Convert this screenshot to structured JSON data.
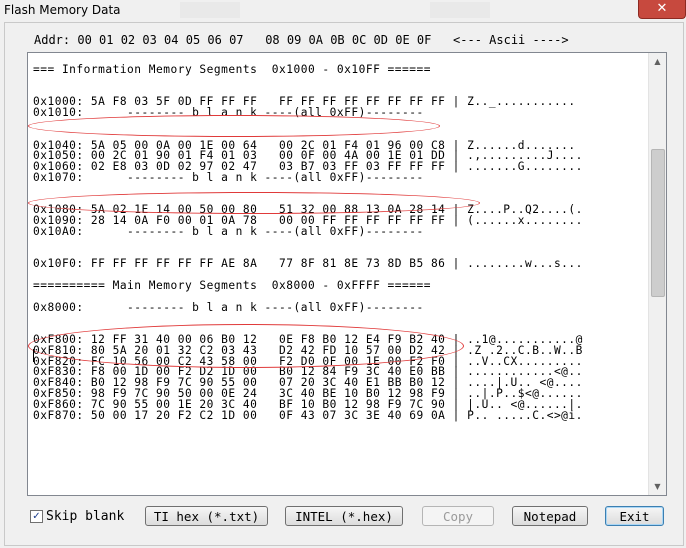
{
  "window": {
    "title": "Flash Memory Data",
    "close_glyph": "✕"
  },
  "header": {
    "addr_line": "Addr: 00 01 02 03 04 05 06 07   08 09 0A 0B 0C 0D 0E 0F   <--- Ascii ---->"
  },
  "dump": {
    "lines": [
      "=== Information Memory Segments  0x1000 - 0x10FF ======",
      "",
      "",
      "0x1000: 5A F8 03 5F 0D FF FF FF   FF FF FF FF FF FF FF FF | Z.._...........",
      "0x1010:      -------- b l a n k ----(all 0xFF)--------",
      "",
      "",
      "0x1040: 5A 05 00 0A 00 1E 00 64   00 2C 01 F4 01 96 00 C8 | Z......d.......",
      "0x1050: 00 2C 01 90 01 F4 01 03   00 0F 00 4A 00 1E 01 DD | .,.........J....",
      "0x1060: 02 E8 03 0D 02 97 02 47   03 B7 03 FF 03 FF FF FF | .......G........",
      "0x1070:      -------- b l a n k ----(all 0xFF)--------",
      "",
      "",
      "0x1080: 5A 02 1E 14 00 50 00 80   51 32 00 88 13 0A 28 14 | Z....P..Q2....(.",
      "0x1090: 28 14 0A F0 00 01 0A 78   00 00 FF FF FF FF FF FF | (......x........",
      "0x10A0:      -------- b l a n k ----(all 0xFF)--------",
      "",
      "",
      "0x10F0: FF FF FF FF FF FF AE 8A   77 8F 81 8E 73 8D B5 86 | ........w...s...",
      "",
      "========== Main Memory Segments  0x8000 - 0xFFFF ======",
      "",
      "0x8000:      -------- b l a n k ----(all 0xFF)--------",
      "",
      "",
      "0xF800: 12 FF 31 40 00 06 B0 12   0E F8 B0 12 E4 F9 B2 40 | ..1@...........@",
      "0xF810: 80 5A 20 01 32 C2 03 43   D2 42 FD 10 57 00 D2 42 | .Z .2..C.B..W..B",
      "0xF820: FC 10 56 00 C2 43 58 00   F2 D0 0F 00 1E 00 F2 F0 | ..V..CX.........",
      "0xF830: F8 00 1D 00 F2 D2 1D 00   B0 12 84 F9 3C 40 E0 BB | ............<@..",
      "0xF840: B0 12 98 F9 7C 90 55 00   07 20 3C 40 E1 BB B0 12 | ....|.U.. <@....",
      "0xF850: 98 F9 7C 90 50 00 0E 24   3C 40 BE 10 B0 12 98 F9 | ..|.P..$<@......",
      "0xF860: 7C 90 55 00 1E 20 3C 40   BF 10 B0 12 98 F9 7C 90 | |.U.. <@......|.",
      "0xF870: 50 00 17 20 F2 C2 1D 00   0F 43 07 3C 3E 40 69 0A | P.. .....C.<>@i."
    ]
  },
  "footer": {
    "skip_blank_label": "Skip blank",
    "skip_blank_checked": "✓",
    "ti_hex_label": "TI hex (*.txt)",
    "intel_hex_label": "INTEL (*.hex)",
    "copy_label": "Copy",
    "notepad_label": "Notepad",
    "exit_label": "Exit"
  },
  "colors": {
    "annotation_oval": "#e03a3a",
    "close_button": "#c7493e"
  }
}
